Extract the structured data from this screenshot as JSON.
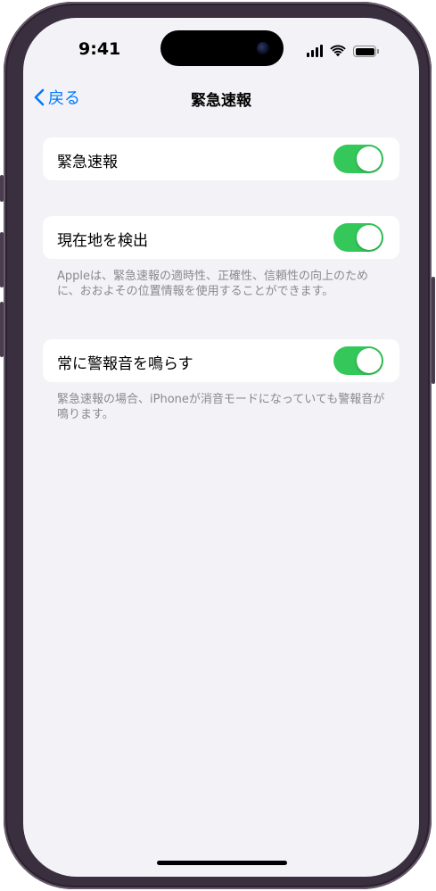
{
  "status_bar": {
    "time": "9:41"
  },
  "nav": {
    "back_label": "戻る",
    "title": "緊急速報"
  },
  "settings": [
    {
      "label": "緊急速報",
      "toggle_on": true
    },
    {
      "label": "現在地を検出",
      "toggle_on": true,
      "footnote": "Appleは、緊急速報の適時性、正確性、信頼性の向上のために、おおよその位置情報を使用することができます。"
    },
    {
      "label": "常に警報音を鳴らす",
      "toggle_on": true,
      "footnote": "緊急速報の場合、iPhoneが消音モードになっていても警報音が鳴ります。"
    }
  ],
  "colors": {
    "accent": "#007aff",
    "toggle_on": "#34c759",
    "background": "#f2f2f7",
    "footnote_text": "#8a8a8e",
    "device_frame": "#3a2f3e"
  },
  "icons": {
    "back": "chevron-left-icon",
    "signal": "cellular-signal-icon",
    "wifi": "wifi-icon",
    "battery": "battery-icon"
  }
}
